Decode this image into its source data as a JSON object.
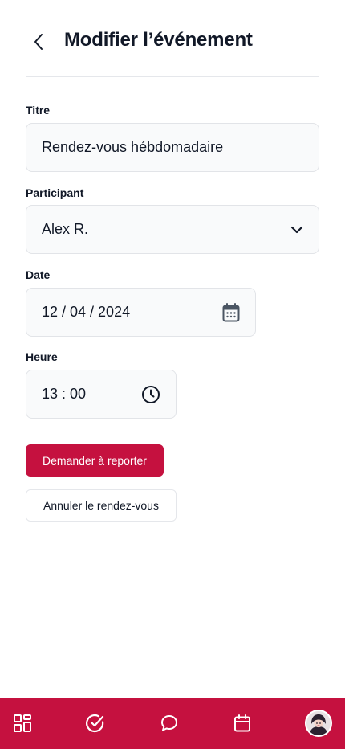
{
  "header": {
    "title": "Modifier l’événement",
    "back_icon": "chevron-left-icon"
  },
  "form": {
    "title_label": "Titre",
    "title_value": "Rendez-vous hébdomadaire",
    "participant_label": "Participant",
    "participant_value": "Alex R.",
    "participant_icon": "chevron-down-icon",
    "date_label": "Date",
    "date_value": "12 / 04 / 2024",
    "date_icon": "calendar-icon",
    "time_label": "Heure",
    "time_value": "13 : 00",
    "time_icon": "clock-icon"
  },
  "actions": {
    "reschedule_label": "Demander à reporter",
    "cancel_label": "Annuler le rendez-vous"
  },
  "nav": {
    "items": [
      {
        "icon": "dashboard-grid-icon"
      },
      {
        "icon": "check-circle-icon"
      },
      {
        "icon": "chat-bubble-icon"
      },
      {
        "icon": "calendar-icon"
      },
      {
        "icon": "avatar"
      }
    ]
  },
  "colors": {
    "primary": "#c5113f",
    "field_bg": "#f9fafb",
    "field_border": "#e2e4e8",
    "text": "#111827"
  }
}
